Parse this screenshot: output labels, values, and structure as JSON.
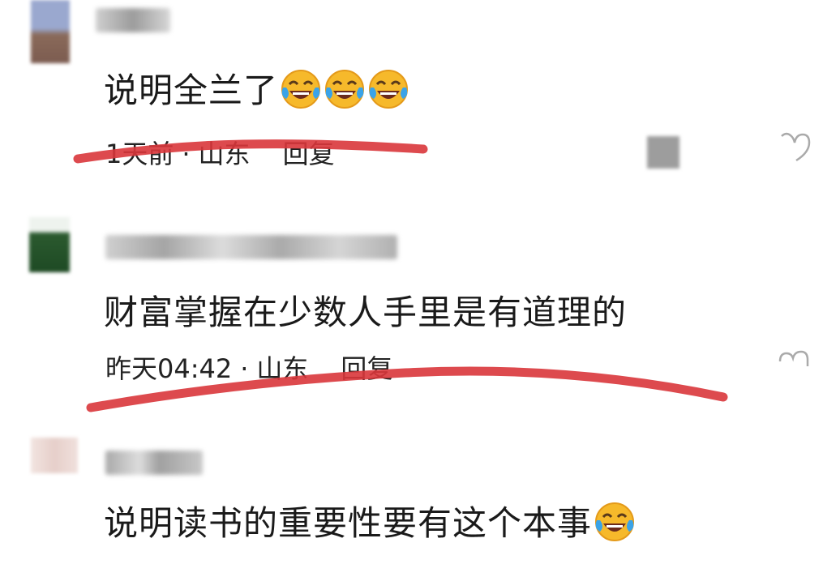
{
  "comments": [
    {
      "text": "说明全兰了",
      "time": "1天前",
      "location": "山东",
      "reply_label": "回复",
      "emoji": [
        "laugh-cry-emoji",
        "laugh-cry-emoji",
        "laugh-cry-emoji"
      ]
    },
    {
      "text": "财富掌握在少数人手里是有道理的",
      "time": "昨天04:42",
      "location": "山东",
      "reply_label": "回复",
      "emoji": []
    },
    {
      "text": "说明读书的重要性要有这个本事",
      "emoji": [
        "laugh-cry-emoji"
      ]
    }
  ],
  "separator": "·",
  "colors": {
    "scribble": "#d9363b",
    "text": "#1a1a1a",
    "like_icon": "#bbbbbb"
  }
}
